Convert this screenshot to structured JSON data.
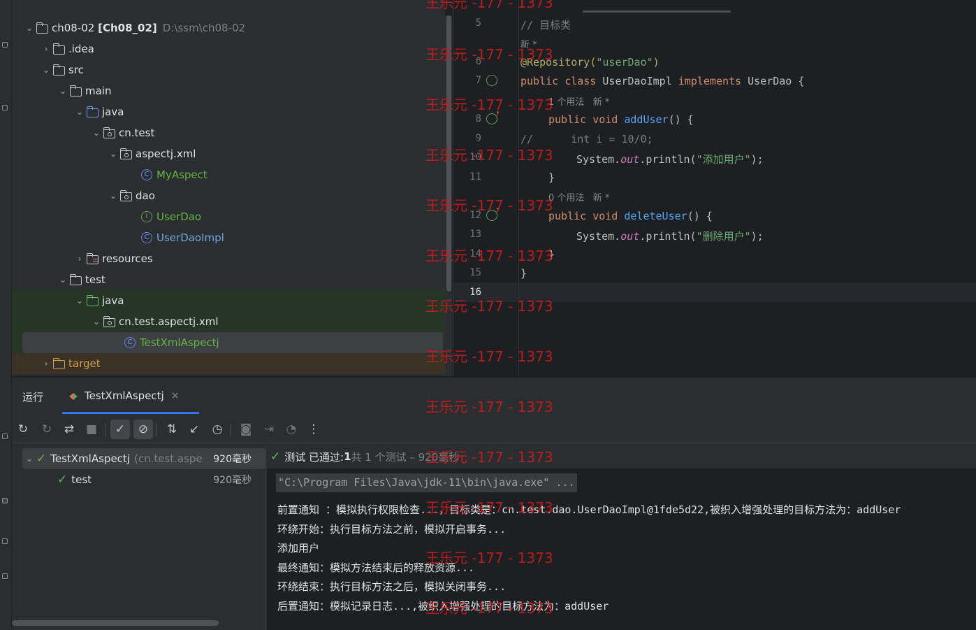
{
  "project_tree": {
    "root": {
      "name": "ch08-02",
      "module": "[Ch08_02]",
      "path": "D:\\ssm\\ch08-02"
    },
    "items": [
      {
        "label": ".idea"
      },
      {
        "label": "src"
      },
      {
        "label": "main"
      },
      {
        "label": "java"
      },
      {
        "label": "cn.test"
      },
      {
        "label": "aspectj.xml"
      },
      {
        "label": "MyAspect"
      },
      {
        "label": "dao"
      },
      {
        "label": "UserDao"
      },
      {
        "label": "UserDaoImpl"
      },
      {
        "label": "resources"
      },
      {
        "label": "test"
      },
      {
        "label": "java"
      },
      {
        "label": "cn.test.aspectj.xml"
      },
      {
        "label": "TestXmlAspectj"
      },
      {
        "label": "target"
      }
    ]
  },
  "editor": {
    "line_numbers": [
      "5",
      "6",
      "7",
      "8",
      "9",
      "10",
      "11",
      "12",
      "13",
      "14",
      "15",
      "16"
    ],
    "lines": {
      "l5_comment": "// 目标类",
      "hint_new_1": "新 *",
      "l6_annotation": "@Repository(",
      "l6_string": "\"userDao\"",
      "l6_close": ")",
      "l7_kw1": "public class",
      "l7_name": " UserDaoImpl ",
      "l7_kw2": "implements",
      "l7_rest": " UserDao {",
      "hint_usage_1": "1 个用法   新 *",
      "l8_kw": "public void",
      "l8_fn": "addUser",
      "l8_rest": "() {",
      "l9_comment": "//      int i = 10/0;",
      "l10_pre": "System.",
      "l10_field": "out",
      "l10_mid": ".println(",
      "l10_str": "\"添加用户\"",
      "l10_end": ");",
      "l11": "}",
      "hint_usage_2": "0 个用法   新 *",
      "l12_kw": "public void",
      "l12_fn": "deleteUser",
      "l12_rest": "() {",
      "l13_pre": "System.",
      "l13_field": "out",
      "l13_mid": ".println(",
      "l13_str": "\"删除用户\"",
      "l13_end": ");",
      "l14": "}",
      "l15": "}"
    }
  },
  "watermark": "王乐元 -177 - 1373",
  "run_panel": {
    "label": "运行",
    "tab_label": "TestXmlAspectj",
    "tab_close": "×",
    "results": [
      {
        "name": "TestXmlAspectj",
        "detail": "(cn.test.aspe",
        "duration": "920毫秒"
      },
      {
        "name": "test",
        "detail": "",
        "duration": "920毫秒"
      }
    ],
    "summary": {
      "prefix": "测试 已通过: ",
      "count": "1",
      "suffix": "共 1 个测试 – 920毫秒"
    },
    "console": {
      "command": "\"C:\\Program Files\\Java\\jdk-11\\bin\\java.exe\" ...",
      "lines": [
        "前置通知 ：模拟执行权限检查...，目标类是：cn.test.dao.UserDaoImpl@1fde5d22,被织入增强处理的目标方法为：addUser",
        "环绕开始：执行目标方法之前，模拟开启事务...",
        "添加用户",
        "最终通知：模拟方法结束后的释放资源...",
        "环绕结束：执行目标方法之后，模拟关闭事务...",
        "后置通知：模拟记录日志...,被织入增强处理的目标方法为：addUser"
      ]
    }
  },
  "colors": {
    "keyword": "#cf8e6d",
    "annotation": "#b3ae60",
    "string": "#6aab73",
    "function": "#56a8f5",
    "test_pass": "#5fb85c",
    "accent": "#3574f0",
    "watermark": "#d41d1d"
  },
  "icons": [
    "folder-icon",
    "package-icon",
    "class-icon",
    "interface-icon",
    "rerun-icon",
    "stop-icon",
    "check-icon",
    "cancel-icon",
    "sort-icon",
    "clock-icon",
    "camera-icon",
    "more-icon"
  ]
}
